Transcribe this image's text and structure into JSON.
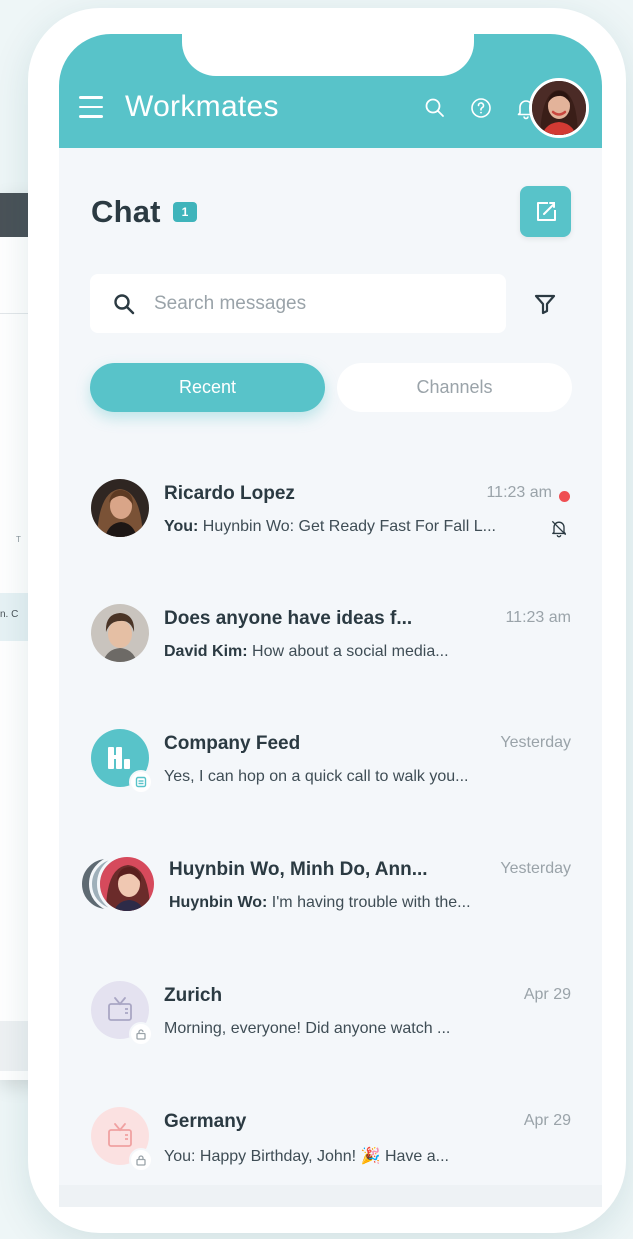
{
  "background_window": {
    "column_header": "T",
    "row_text": "n. C"
  },
  "header": {
    "app_title": "Workmates",
    "accent_color": "#58c3c9"
  },
  "chat": {
    "title": "Chat",
    "unread_count": "1"
  },
  "search": {
    "placeholder": "Search messages",
    "value": ""
  },
  "tabs": [
    {
      "label": "Recent",
      "active": true
    },
    {
      "label": "Channels",
      "active": false
    }
  ],
  "conversations": [
    {
      "name": "Ricardo Lopez",
      "time": "11:23 am",
      "sender": "You:",
      "message": " Huynbin Wo: Get Ready Fast For Fall L...",
      "unread": true,
      "muted": true
    },
    {
      "name": "Does anyone have ideas f...",
      "time": "11:23 am",
      "sender": "David Kim:",
      "message": " How about a social media..."
    },
    {
      "name": "Company Feed",
      "time": "Yesterday",
      "sender": "",
      "message": "Yes, I can hop on a quick call to walk you..."
    },
    {
      "name": "Huynbin Wo, Minh Do, Ann...",
      "time": "Yesterday",
      "sender": "Huynbin Wo:",
      "message": " I'm having trouble with the..."
    },
    {
      "name": "Zurich",
      "time": "Apr 29",
      "sender": "",
      "message": "Morning, everyone! Did anyone watch ..."
    },
    {
      "name": "Germany",
      "time": "Apr 29",
      "sender": "",
      "message": "You: Happy Birthday, John! 🎉 Have a..."
    }
  ]
}
